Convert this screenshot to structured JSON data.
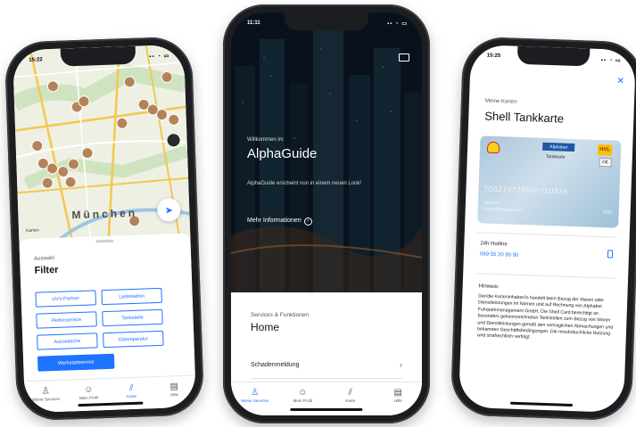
{
  "phone_map": {
    "status_time": "15:22",
    "map_city": "München",
    "map_attribution": "Karten",
    "sheet": {
      "subtitle": "Auswahl",
      "title": "Filter",
      "filters": [
        {
          "label": "UVV-Partner",
          "active": false
        },
        {
          "label": "Ladestation",
          "active": false
        },
        {
          "label": "Reifenservice",
          "active": false
        },
        {
          "label": "Tankstelle",
          "active": false
        },
        {
          "label": "Autowäsche",
          "active": false
        },
        {
          "label": "Glasreparatur",
          "active": false
        },
        {
          "label": "Werkstattservice",
          "active": true
        }
      ]
    },
    "tabs": [
      {
        "label": "Meine Services",
        "icon": "person-icon",
        "active": false
      },
      {
        "label": "Mein Profil",
        "icon": "profile-icon",
        "active": false
      },
      {
        "label": "Karte",
        "icon": "map-icon",
        "active": true
      },
      {
        "label": "Hilfe",
        "icon": "chat-icon",
        "active": false
      }
    ]
  },
  "phone_home": {
    "status_time": "11:11",
    "welcome": "Willkommen im",
    "brand": "AlphaGuide",
    "teaser": "AlphaGuide erscheint nun in einem neuen Look!",
    "more_info": "Mehr Informationen",
    "panel": {
      "subtitle": "Services & Funktionen",
      "title": "Home",
      "row": "Schadenmeldung"
    },
    "tabs": [
      {
        "label": "Meine Services",
        "icon": "person-icon",
        "active": true
      },
      {
        "label": "Mein Profil",
        "icon": "profile-icon",
        "active": false
      },
      {
        "label": "Karte",
        "icon": "map-icon",
        "active": false
      },
      {
        "label": "Hilfe",
        "icon": "chat-icon",
        "active": false
      }
    ]
  },
  "phone_card": {
    "status_time": "15:25",
    "subtitle": "Meine Karten",
    "title": "Shell Tankkarte",
    "card": {
      "issuer_badge": "Alphabet",
      "card_label": "Tankkarte",
      "hvl": "HVL",
      "country": "DE",
      "number": "70021472858h460835",
      "line1": "Alphabet",
      "line2": "Fuhrparkmanagement",
      "expiry": "5/25"
    },
    "hotline_label": "24h Hotline",
    "hotline_number": "089 55 20 90 90",
    "hint_label": "Hinweis:",
    "hint_text": "Der/die Karteninhaber/in handelt beim Bezug der Waren oder Dienstleistungen im Namen und auf Rechnung von Alphabet Fuhrparkmanagement GmbH. Die Shell Card berechtigt an besonders gekennzeichneten Tankstellen zum Bezug von Waren und Dienstleistungen gemäß den vertraglichen Abmachungen und bekannten Geschäftsbedingungen. Die missbräuchliche Nutzung wird strafrechtlich verfolgt."
  },
  "colors": {
    "accent": "#1e73ff",
    "map_pin": "#b5835a",
    "road": "#f2c94c",
    "park": "#cfe3c0"
  }
}
